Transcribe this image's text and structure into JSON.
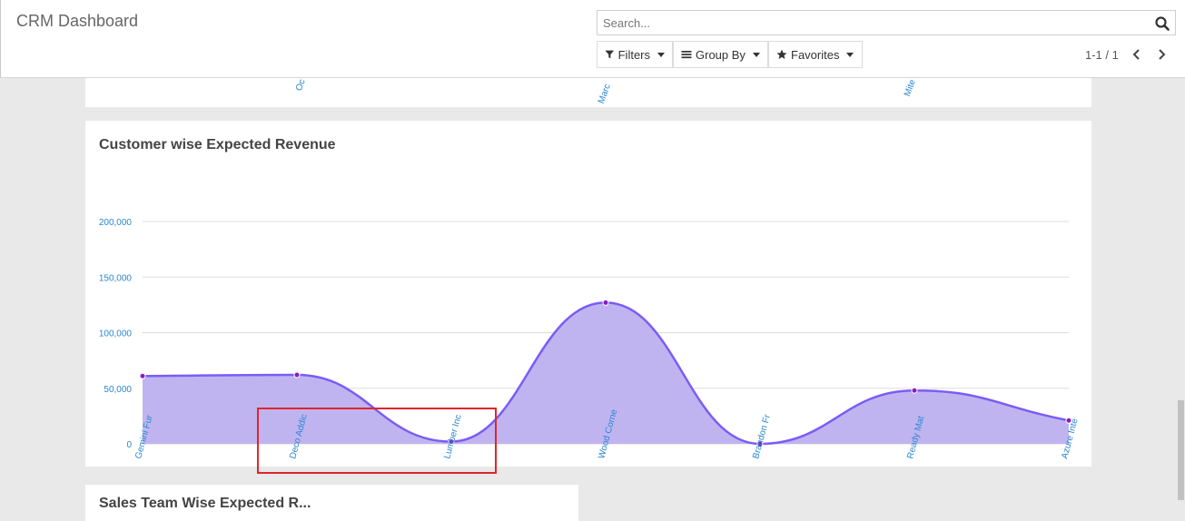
{
  "header": {
    "title": "CRM Dashboard",
    "search_placeholder": "Search...",
    "filters_label": "Filters",
    "group_by_label": "Group By",
    "favorites_label": "Favorites",
    "pager": "1-1 / 1"
  },
  "top_card": {
    "labels": [
      "Oc",
      "Marc",
      "Mite"
    ]
  },
  "bottom_card": {
    "title": "Sales Team Wise Expected R..."
  },
  "colors": {
    "accent": "#7b5cf5",
    "area_fill": "#c0b4f0",
    "tick_label": "#2a87d0",
    "highlight": "#e0252c"
  },
  "chart_data": {
    "type": "area",
    "title": "Customer wise Expected Revenue",
    "categories": [
      "Gemini Fur",
      "Deco Addic",
      "Lumber Inc",
      "Wood Corne",
      "Brandon Fr",
      "Ready Mat",
      "Azure Inte"
    ],
    "values": [
      61000,
      62000,
      2000,
      127000,
      0,
      48000,
      21000
    ],
    "yticks": [
      "0",
      "50,000",
      "100,000",
      "150,000",
      "200,000"
    ],
    "ylim": [
      0,
      200000
    ],
    "xlabel": "",
    "ylabel": "",
    "grid": true,
    "legend": "none"
  }
}
